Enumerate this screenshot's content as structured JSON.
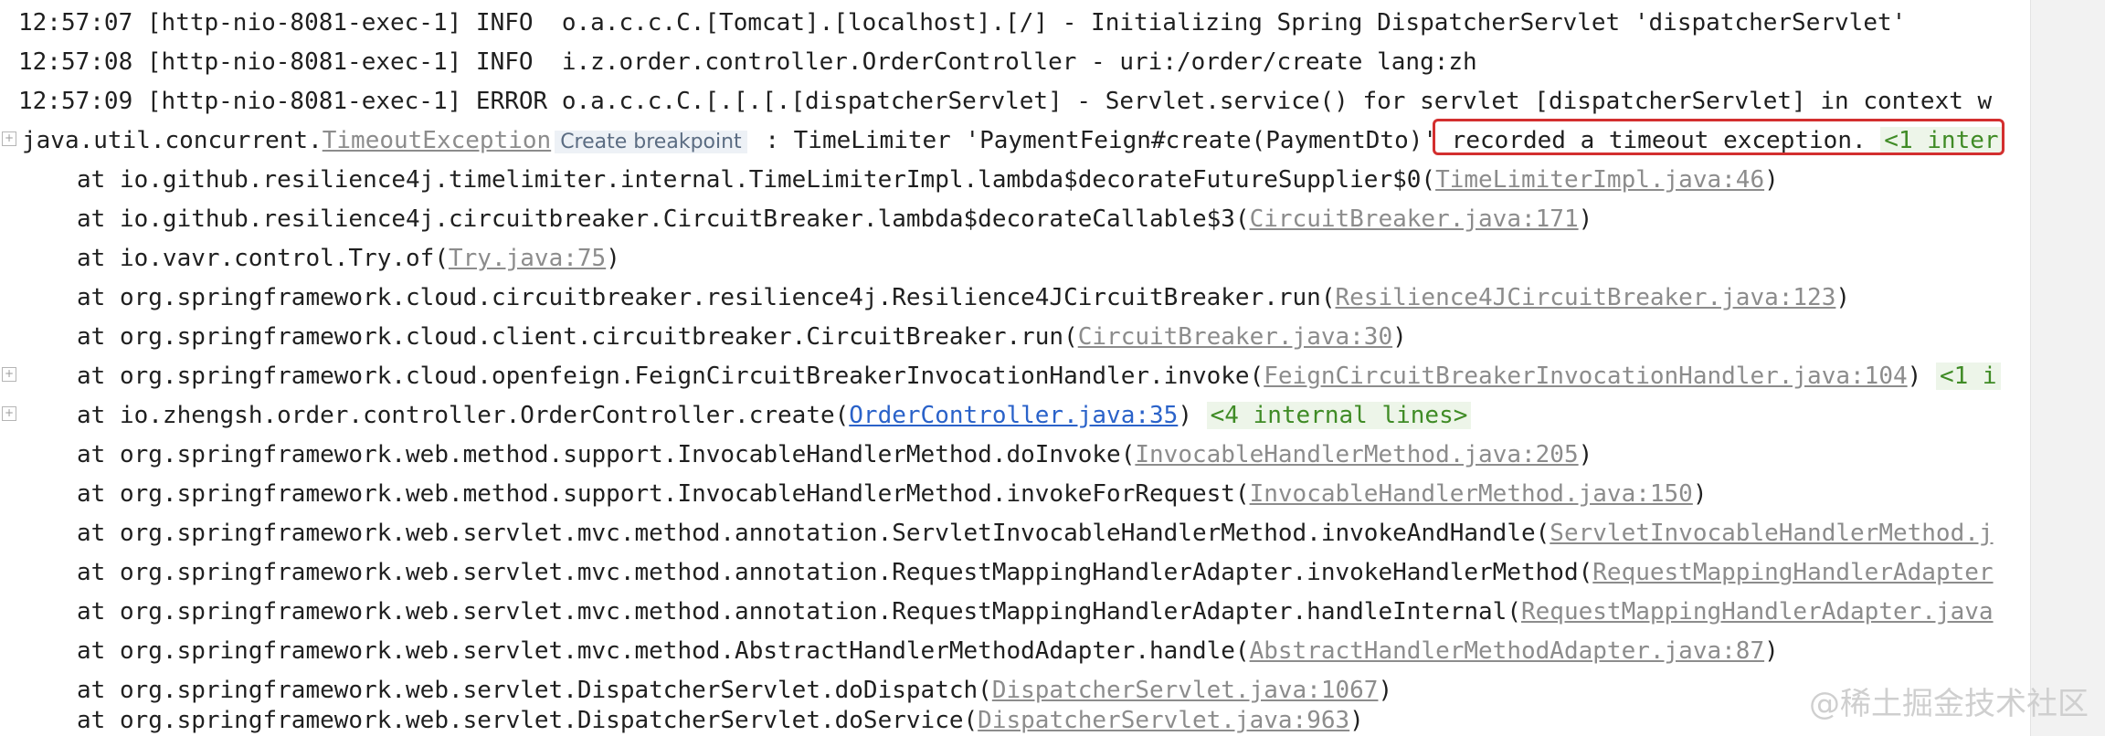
{
  "log_lines": [
    {
      "time": "12:57:07",
      "thread": "[http-nio-8081-exec-1]",
      "level": "INFO ",
      "logger": "o.a.c.c.C.[Tomcat].[localhost].[/]",
      "message": "- Initializing Spring DispatcherServlet 'dispatcherServlet'"
    },
    {
      "time": "12:57:08",
      "thread": "[http-nio-8081-exec-1]",
      "level": "INFO ",
      "logger": "i.z.order.controller.OrderController",
      "message": "- uri:/order/create lang:zh"
    },
    {
      "time": "12:57:09",
      "thread": "[http-nio-8081-exec-1]",
      "level": "ERROR",
      "logger": "o.a.c.c.C.[.[.[.[dispatcherServlet]",
      "message": "- Servlet.service() for servlet [dispatcherServlet] in context w"
    }
  ],
  "exception": {
    "package": "java.util.concurrent.",
    "class_link": "TimeoutException",
    "breakpoint_hint": "Create breakpoint",
    "message": " : TimeLimiter 'PaymentFeign#create(PaymentDto)' recorded a timeout exception.",
    "internal": "<1 inter"
  },
  "frames": [
    {
      "method": "at io.github.resilience4j.timelimiter.internal.TimeLimiterImpl.lambda$decorateFutureSupplier$0(",
      "file": "TimeLimiterImpl.java:46",
      "close": ")",
      "internal": ""
    },
    {
      "method": "at io.github.resilience4j.circuitbreaker.CircuitBreaker.lambda$decorateCallable$3(",
      "file": "CircuitBreaker.java:171",
      "close": ")",
      "internal": ""
    },
    {
      "method": "at io.vavr.control.Try.of(",
      "file": "Try.java:75",
      "close": ")",
      "internal": ""
    },
    {
      "method": "at org.springframework.cloud.circuitbreaker.resilience4j.Resilience4JCircuitBreaker.run(",
      "file": "Resilience4JCircuitBreaker.java:123",
      "close": ")",
      "internal": ""
    },
    {
      "method": "at org.springframework.cloud.client.circuitbreaker.CircuitBreaker.run(",
      "file": "CircuitBreaker.java:30",
      "close": ")",
      "internal": ""
    },
    {
      "method": "at org.springframework.cloud.openfeign.FeignCircuitBreakerInvocationHandler.invoke(",
      "file": "FeignCircuitBreakerInvocationHandler.java:104",
      "close": ")",
      "internal": "<1 i"
    },
    {
      "method": "at io.zhengsh.order.controller.OrderController.create(",
      "file": "OrderController.java:35",
      "close": ")",
      "internal": "<4 internal lines>"
    },
    {
      "method": "at org.springframework.web.method.support.InvocableHandlerMethod.doInvoke(",
      "file": "InvocableHandlerMethod.java:205",
      "close": ")",
      "internal": ""
    },
    {
      "method": "at org.springframework.web.method.support.InvocableHandlerMethod.invokeForRequest(",
      "file": "InvocableHandlerMethod.java:150",
      "close": ")",
      "internal": ""
    },
    {
      "method": "at org.springframework.web.servlet.mvc.method.annotation.ServletInvocableHandlerMethod.invokeAndHandle(",
      "file": "ServletInvocableHandlerMethod.j",
      "close": "",
      "internal": ""
    },
    {
      "method": "at org.springframework.web.servlet.mvc.method.annotation.RequestMappingHandlerAdapter.invokeHandlerMethod(",
      "file": "RequestMappingHandlerAdapter",
      "close": "",
      "internal": ""
    },
    {
      "method": "at org.springframework.web.servlet.mvc.method.annotation.RequestMappingHandlerAdapter.handleInternal(",
      "file": "RequestMappingHandlerAdapter.java",
      "close": "",
      "internal": ""
    },
    {
      "method": "at org.springframework.web.servlet.mvc.method.AbstractHandlerMethodAdapter.handle(",
      "file": "AbstractHandlerMethodAdapter.java:87",
      "close": ")",
      "internal": ""
    },
    {
      "method": "at org.springframework.web.servlet.DispatcherServlet.doDispatch(",
      "file": "DispatcherServlet.java:1067",
      "close": ")",
      "internal": ""
    },
    {
      "method": "at org.springframework.web.servlet.DispatcherServlet.doService(",
      "file": "DispatcherServlet.java:963",
      "close": ")",
      "internal": ""
    }
  ],
  "gutter": {
    "expand_symbol": "+"
  },
  "watermark": "@稀土掘金技术社区",
  "colors": {
    "link_grey": "#8c8c8c",
    "link_blue": "#2a62c9",
    "internal_bg": "#edf5e9",
    "internal_fg": "#3f8b25",
    "highlight": "#d32f2f"
  }
}
